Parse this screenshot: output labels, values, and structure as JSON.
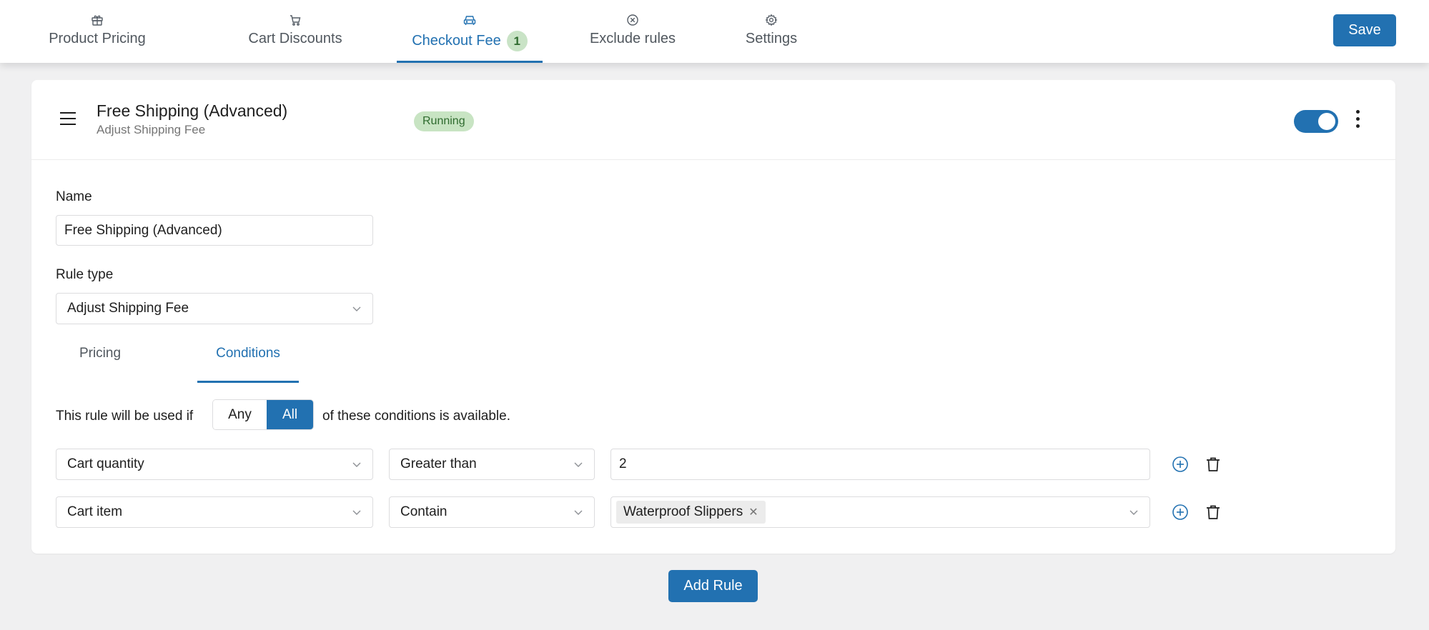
{
  "nav": {
    "tabs": [
      {
        "label": "Product Pricing",
        "icon": "gift-icon"
      },
      {
        "label": "Cart Discounts",
        "icon": "cart-icon"
      },
      {
        "label": "Checkout Fee",
        "icon": "car-icon",
        "badge": "1",
        "active": true
      },
      {
        "label": "Exclude rules",
        "icon": "x-circle-icon"
      },
      {
        "label": "Settings",
        "icon": "gear-icon"
      }
    ],
    "save_label": "Save"
  },
  "rule": {
    "title": "Free Shipping (Advanced)",
    "subtitle": "Adjust Shipping Fee",
    "status": "Running",
    "enabled": true
  },
  "form": {
    "name_label": "Name",
    "name_value": "Free Shipping (Advanced)",
    "rule_type_label": "Rule type",
    "rule_type_value": "Adjust Shipping Fee"
  },
  "subtabs": [
    {
      "label": "Pricing",
      "active": false
    },
    {
      "label": "Conditions",
      "active": true
    }
  ],
  "conditions": {
    "prefix": "This rule will be used if",
    "match_options": [
      "Any",
      "All"
    ],
    "match_selected": "All",
    "suffix": "of these conditions is available.",
    "rows": [
      {
        "field": "Cart quantity",
        "operator": "Greater than",
        "value": "2"
      },
      {
        "field": "Cart item",
        "operator": "Contain",
        "chips": [
          "Waterproof Slippers"
        ]
      }
    ]
  },
  "add_rule_label": "Add Rule",
  "colors": {
    "accent": "#2271b1",
    "badge_bg": "#c8e4c3",
    "badge_text": "#2f6b2f"
  }
}
